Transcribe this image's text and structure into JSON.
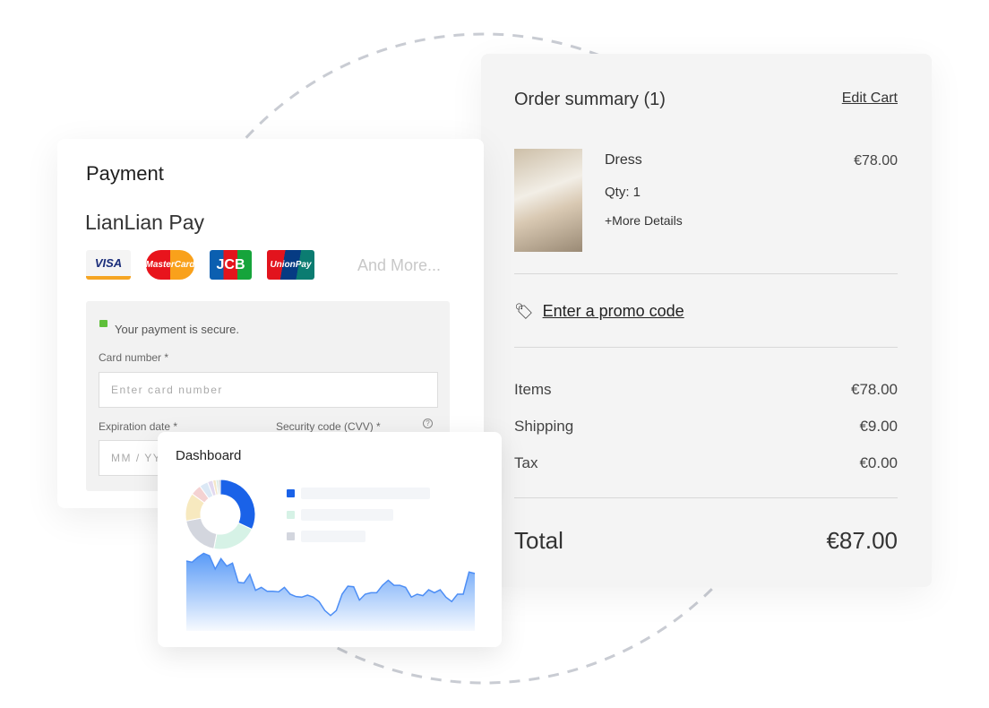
{
  "payment": {
    "title": "Payment",
    "provider": "LianLian Pay",
    "cards": [
      "VISA",
      "MasterCard",
      "JCB",
      "UnionPay"
    ],
    "and_more": "And More...",
    "secure_text": "Your payment is secure.",
    "card_number_label": "Card number *",
    "card_number_placeholder": "Enter card number",
    "expiration_label": "Expiration date *",
    "expiration_placeholder": "MM / YY",
    "cvv_label": "Security code (CVV) *"
  },
  "order": {
    "title": "Order summary (1)",
    "edit_cart": "Edit Cart",
    "item": {
      "name": "Dress",
      "price": "€78.00",
      "qty": "Qty: 1",
      "more": "+More Details"
    },
    "promo": "Enter a promo code",
    "items_label": "Items",
    "items_value": "€78.00",
    "shipping_label": "Shipping",
    "shipping_value": "€9.00",
    "tax_label": "Tax",
    "tax_value": "€0.00",
    "total_label": "Total",
    "total_value": "€87.00"
  },
  "dashboard": {
    "title": "Dashboard",
    "donut": [
      {
        "value": 32,
        "color": "#1a62e8"
      },
      {
        "value": 21,
        "color": "#d6f2e6"
      },
      {
        "value": 19,
        "color": "#d3d6de"
      },
      {
        "value": 13,
        "color": "#f7e9bf"
      },
      {
        "value": 5,
        "color": "#f4d2d2"
      },
      {
        "value": 4,
        "color": "#dbe8f5"
      },
      {
        "value": 2.5,
        "color": "#e2d9ef"
      },
      {
        "value": 1.5,
        "color": "#f4e6c8"
      },
      {
        "value": 1,
        "color": "#cfe6dd"
      },
      {
        "value": 1,
        "color": "#c9cdd6"
      }
    ],
    "legend_colors": [
      "#1a62e8",
      "#d6f2e6",
      "#d3d6de"
    ],
    "sparkline": [
      212,
      208,
      225,
      238,
      230,
      185,
      220,
      195,
      205,
      140,
      138,
      167,
      113,
      123,
      110,
      110,
      108,
      123,
      100,
      92,
      90,
      97,
      90,
      75,
      45,
      28,
      45,
      100,
      127,
      125,
      80,
      100,
      105,
      105,
      130,
      147,
      130,
      130,
      123,
      90,
      100,
      95,
      115,
      105,
      115,
      90,
      75,
      100,
      100,
      175,
      170
    ]
  }
}
